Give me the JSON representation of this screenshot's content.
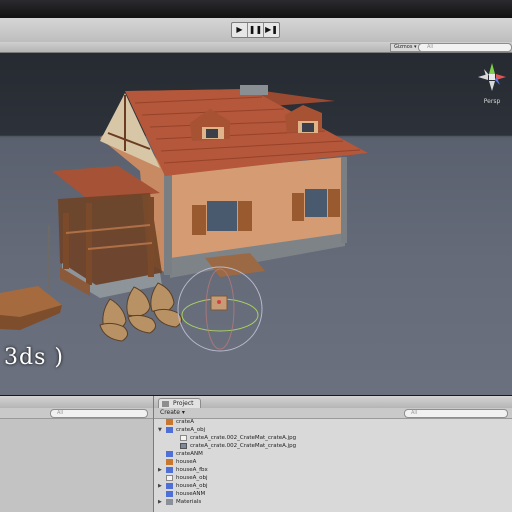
{
  "toolbar": {
    "play_icon": "▶",
    "pause_icon": "❚❚",
    "step_icon": "▶❚"
  },
  "scene_view": {
    "gizmos_label": "Gizmos ▾",
    "search_placeholder": "All",
    "persp_label": "Persp",
    "overlay_text": "3ds )"
  },
  "hierarchy": {
    "search_placeholder": "All"
  },
  "project": {
    "tab_label": "Project",
    "create_label": "Create ▾",
    "search_placeholder": "All",
    "items": [
      {
        "label": "crateA",
        "icon": "prefab-icon",
        "color": "orange",
        "level": 1,
        "arrow": ""
      },
      {
        "label": "crateA_obj",
        "icon": "model-icon",
        "color": "blue",
        "level": 1,
        "arrow": "▼"
      },
      {
        "label": "crateA_crate.002_CrateMat_crateA.jpg",
        "icon": "material-icon",
        "color": "doc",
        "level": 2,
        "arrow": ""
      },
      {
        "label": "crateA_crate.002_CrateMat_crateA.jpg",
        "icon": "image-icon",
        "color": "img",
        "level": 2,
        "arrow": ""
      },
      {
        "label": "crateANM",
        "icon": "mesh-icon",
        "color": "blue",
        "level": 1,
        "arrow": ""
      },
      {
        "label": "houseA",
        "icon": "prefab-icon",
        "color": "orange",
        "level": 1,
        "arrow": ""
      },
      {
        "label": "houseA_fbx",
        "icon": "model-icon",
        "color": "blue",
        "level": 1,
        "arrow": "▶"
      },
      {
        "label": "houseA_obj",
        "icon": "document-icon",
        "color": "doc",
        "level": 1,
        "arrow": ""
      },
      {
        "label": "houseA_obj",
        "icon": "model-icon",
        "color": "blue",
        "level": 1,
        "arrow": "▶"
      },
      {
        "label": "houseANM",
        "icon": "mesh-icon",
        "color": "blue",
        "level": 1,
        "arrow": ""
      },
      {
        "label": "Materials",
        "icon": "folder-icon",
        "color": "folder",
        "level": 1,
        "arrow": "▶"
      }
    ]
  },
  "colors": {
    "toolbar": "#c8c8c8",
    "viewport_sky": "#2a2e35",
    "viewport_ground": "#686e78",
    "project_bg": "#d9d9d9",
    "selection_ring": "#b0b0c8"
  }
}
